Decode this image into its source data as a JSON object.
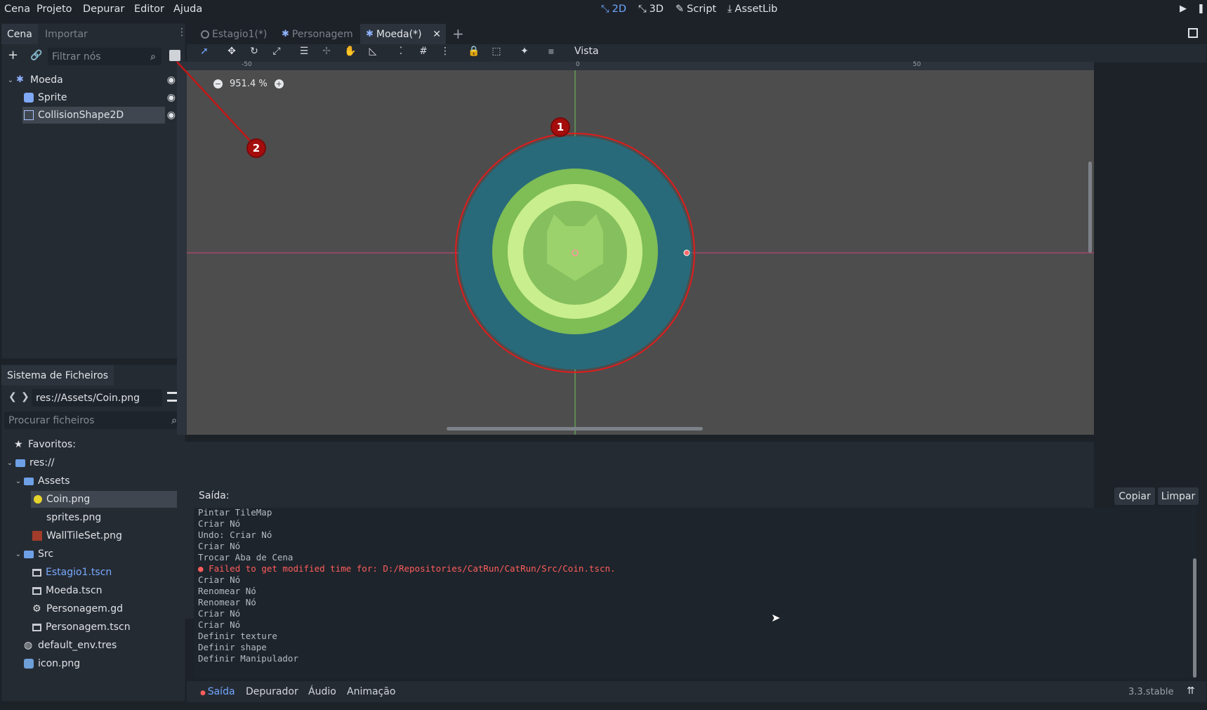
{
  "menu": [
    "Cena",
    "Projeto",
    "Depurar",
    "Editor",
    "Ajuda"
  ],
  "workspaces": {
    "w2d": "2D",
    "w3d": "3D",
    "script": "Script",
    "assetlib": "AssetLib"
  },
  "scene_dock": {
    "tabs": [
      "Cena",
      "Importar"
    ],
    "filter_placeholder": "Filtrar nós",
    "nodes": [
      "Moeda",
      "Sprite",
      "CollisionShape2D"
    ]
  },
  "filesystem": {
    "title": "Sistema de Ficheiros",
    "path": "res://Assets/Coin.png",
    "search_placeholder": "Procurar ficheiros",
    "favorites": "Favoritos:",
    "root": "res://",
    "assets_folder": "Assets",
    "assets_files": [
      "Coin.png",
      "sprites.png",
      "WallTileSet.png"
    ],
    "src_folder": "Src",
    "src_files": [
      "Estagio1.tscn",
      "Moeda.tscn",
      "Personagem.gd",
      "Personagem.tscn"
    ],
    "root_files": [
      "default_env.tres",
      "icon.png"
    ]
  },
  "scene_tabs": [
    "Estagio1(*)",
    "Personagem",
    "Moeda(*)"
  ],
  "toolbar": {
    "vista": "Vista"
  },
  "viewport": {
    "zoom": "951.4 %",
    "ruler_labels": [
      "-50",
      "0",
      "50"
    ]
  },
  "annotations": [
    "1",
    "2"
  ],
  "output": {
    "title": "Saída:",
    "copy": "Copiar",
    "clear": "Limpar",
    "lines": [
      "Pintar TileMap",
      "Criar Nó",
      "Undo: Criar Nó",
      "Criar Nó",
      "Trocar Aba de Cena"
    ],
    "error": "Failed to get modified time for: D:/Repositories/CatRun/CatRun/Src/Coin.tscn.",
    "lines2": [
      "Criar Nó",
      "Renomear Nó",
      "Renomear Nó",
      "Criar Nó",
      "Criar Nó",
      "Definir texture",
      "Definir shape",
      "Definir Manipulador"
    ]
  },
  "bottom_tabs": [
    "Saída",
    "Depurador",
    "Áudio",
    "Animação"
  ],
  "version": "3.3.stable",
  "colors": {
    "accent": "#70a6ff",
    "error": "#ff5d5d",
    "annotation": "#a50d0d"
  }
}
